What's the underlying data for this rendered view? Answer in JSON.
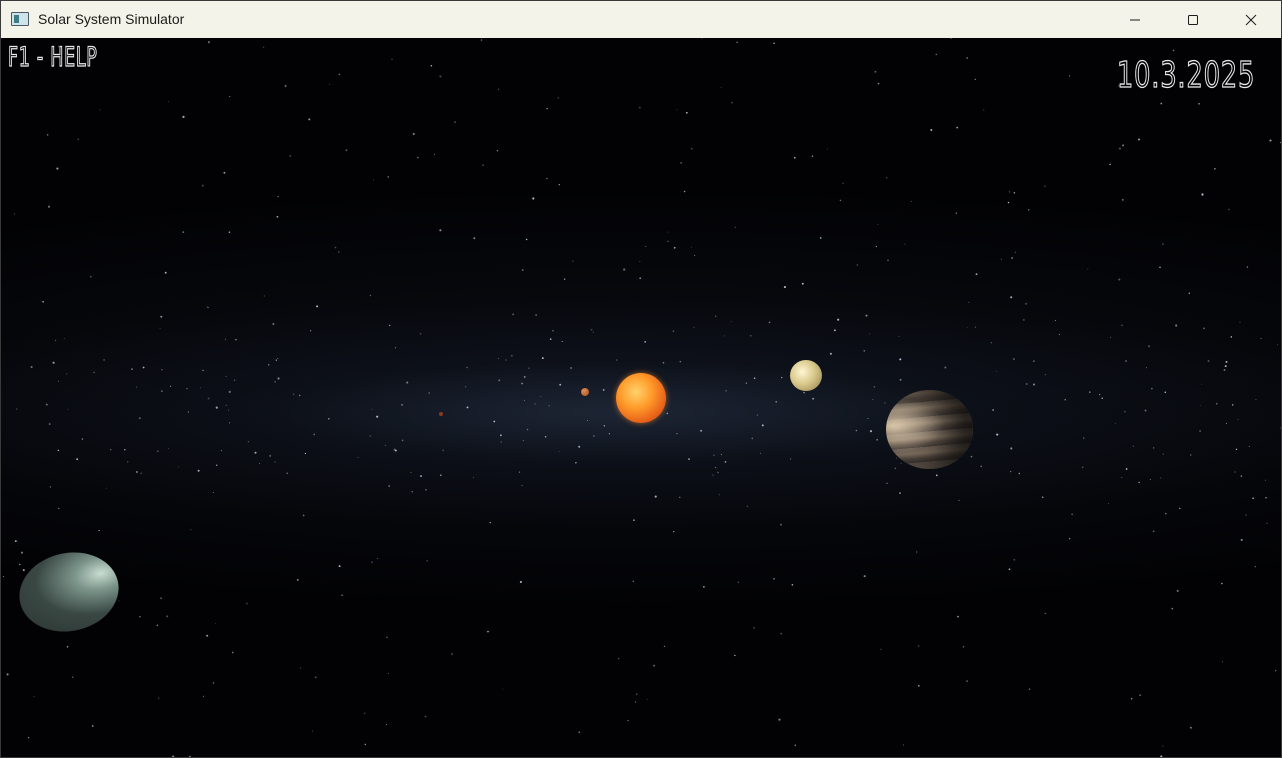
{
  "window": {
    "title": "Solar System Simulator",
    "app_icon": "app-window-icon",
    "controls": {
      "minimize_icon": "minimize-icon",
      "maximize_icon": "maximize-icon",
      "close_icon": "close-icon"
    },
    "titlebar_color": "#f3f3e9"
  },
  "hud": {
    "help_hint": "F1 - HELP",
    "date": "10.3.2025"
  },
  "scene": {
    "background_color": "#020204",
    "bodies": [
      "sun",
      "mercury",
      "mars",
      "venus",
      "jupiter",
      "neptune"
    ],
    "colors": {
      "sun": "#ff9a2a",
      "venus": "#d8c88a",
      "jupiter": "#8a7a68",
      "neptune": "#7c958b"
    }
  }
}
